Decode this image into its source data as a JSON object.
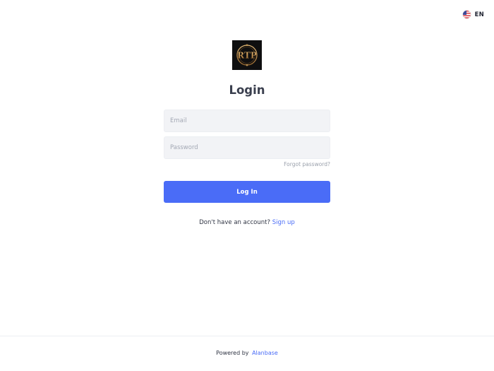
{
  "header": {
    "language_code": "EN",
    "language_flag_icon": "us-flag-icon"
  },
  "logo": {
    "text": "RTP",
    "colors": {
      "background": "#0f0f10",
      "gold": "#c79a55"
    }
  },
  "login_form": {
    "title": "Login",
    "email_placeholder": "Email",
    "password_placeholder": "Password",
    "forgot_password": "Forgot password?",
    "submit_label": "Log In",
    "signup_prompt": "Don't have an account?",
    "signup_link": "Sign up"
  },
  "footer": {
    "powered_by": "Powered by",
    "brand": "Alanbase"
  },
  "colors": {
    "accent": "#4a6cf7",
    "field_background": "#f2f3f6",
    "text": "#2f3443"
  }
}
